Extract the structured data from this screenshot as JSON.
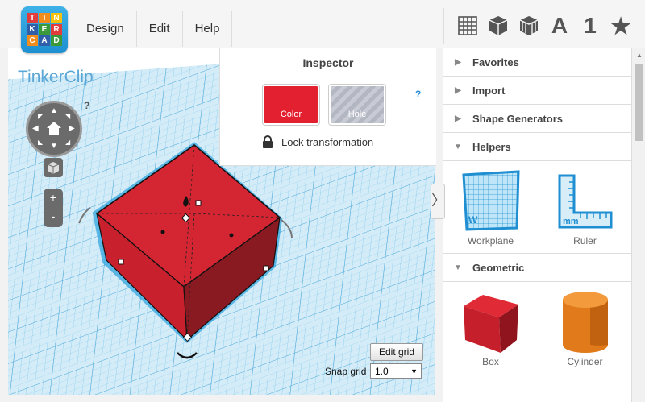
{
  "logo": {
    "letters": [
      "T",
      "I",
      "N",
      "K",
      "E",
      "R",
      "C",
      "A",
      "D"
    ]
  },
  "menu": [
    "Design",
    "Edit",
    "Help"
  ],
  "tools": [
    {
      "icon": "workplane-grid-icon"
    },
    {
      "icon": "box-shape-icon"
    },
    {
      "icon": "striped-box-icon"
    },
    {
      "icon": "text-a-icon",
      "text": "A"
    },
    {
      "icon": "number-one-icon",
      "text": "1"
    },
    {
      "icon": "star-icon",
      "text": "★"
    }
  ],
  "app_title": "TinkerClip",
  "inspector": {
    "title": "Inspector",
    "color_label": "Color",
    "hole_label": "Hole",
    "help": "?",
    "lock_label": "Lock transformation"
  },
  "view_help": "?",
  "zoom": {
    "plus": "+",
    "minus": "-"
  },
  "grid": {
    "edit_label": "Edit grid",
    "snap_label": "Snap grid",
    "snap_value": "1.0"
  },
  "sidebar": {
    "favorites": "Favorites",
    "import": "Import",
    "shape_generators": "Shape Generators",
    "helpers": "Helpers",
    "geometric": "Geometric",
    "helper_items": [
      "Workplane",
      "Ruler"
    ],
    "geometric_items": [
      "Box",
      "Cylinder"
    ],
    "workplane_mark": "W",
    "ruler_mark": "mm"
  },
  "colors": {
    "accent": "#e3202f",
    "grid": "#4fb0e0",
    "cylinder": "#e07a1a"
  }
}
